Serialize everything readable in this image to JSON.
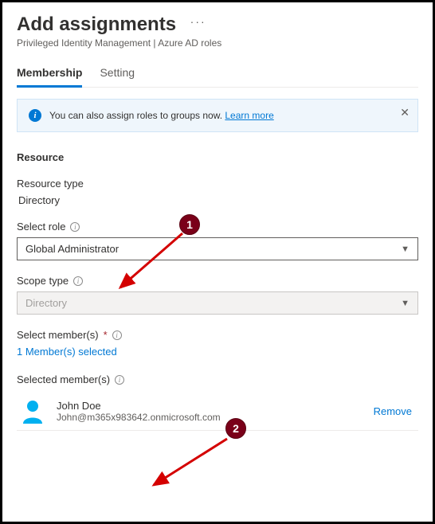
{
  "header": {
    "title": "Add assignments",
    "breadcrumb": "Privileged Identity Management | Azure AD roles"
  },
  "tabs": {
    "membership": "Membership",
    "setting": "Setting"
  },
  "info": {
    "text": "You can also assign roles to groups now. ",
    "link": "Learn more"
  },
  "sections": {
    "resource": "Resource",
    "resource_type_label": "Resource type",
    "resource_type_value": "Directory",
    "select_role_label": "Select role",
    "select_role_value": "Global Administrator",
    "scope_type_label": "Scope type",
    "scope_type_value": "Directory",
    "select_members_label": "Select member(s)",
    "members_selected_link": "1 Member(s) selected",
    "selected_members_label": "Selected member(s)"
  },
  "member": {
    "name": "John Doe",
    "email": "John@m365x983642.onmicrosoft.com",
    "remove": "Remove"
  },
  "annotations": {
    "badge1": "1",
    "badge2": "2"
  }
}
